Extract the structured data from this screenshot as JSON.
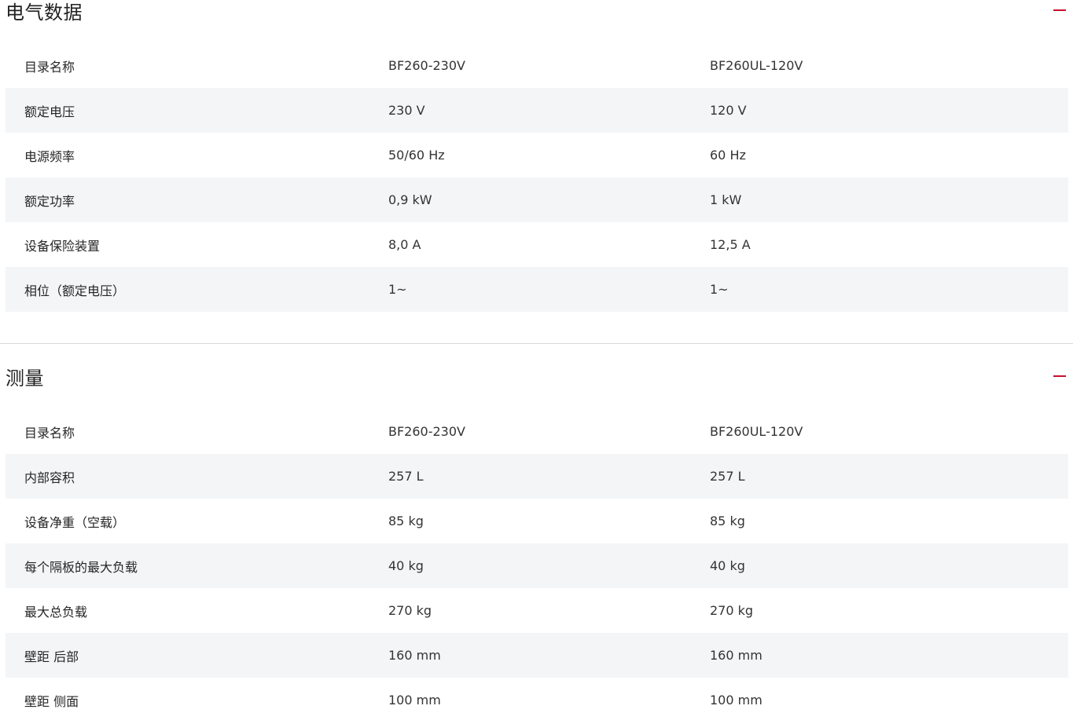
{
  "colors": {
    "accent": "#c8102e",
    "row_alt_bg": "#f4f5f7",
    "divider": "#d9d9d9"
  },
  "sections": [
    {
      "title": "电气数据",
      "toggle_icon": "minus-icon",
      "rows": [
        {
          "label": "目录名称",
          "v1": "BF260-230V",
          "v2": "BF260UL-120V"
        },
        {
          "label": "额定电压",
          "v1": "230 V",
          "v2": "120 V"
        },
        {
          "label": "电源频率",
          "v1": "50/60 Hz",
          "v2": "60 Hz"
        },
        {
          "label": "额定功率",
          "v1": "0,9 kW",
          "v2": "1 kW"
        },
        {
          "label": "设备保险装置",
          "v1": "8,0 A",
          "v2": "12,5 A"
        },
        {
          "label": "相位（额定电压）",
          "v1": "1~",
          "v2": "1~"
        }
      ]
    },
    {
      "title": "测量",
      "toggle_icon": "minus-icon",
      "rows": [
        {
          "label": "目录名称",
          "v1": "BF260-230V",
          "v2": "BF260UL-120V"
        },
        {
          "label": "内部容积",
          "v1": "257 L",
          "v2": "257 L"
        },
        {
          "label": "设备净重（空载）",
          "v1": "85 kg",
          "v2": "85 kg"
        },
        {
          "label": "每个隔板的最大负载",
          "v1": "40 kg",
          "v2": "40 kg"
        },
        {
          "label": "最大总负载",
          "v1": "270 kg",
          "v2": "270 kg"
        },
        {
          "label": "壁距 后部",
          "v1": "160 mm",
          "v2": "160 mm"
        },
        {
          "label": "壁距 侧面",
          "v1": "100 mm",
          "v2": "100 mm"
        }
      ]
    }
  ]
}
